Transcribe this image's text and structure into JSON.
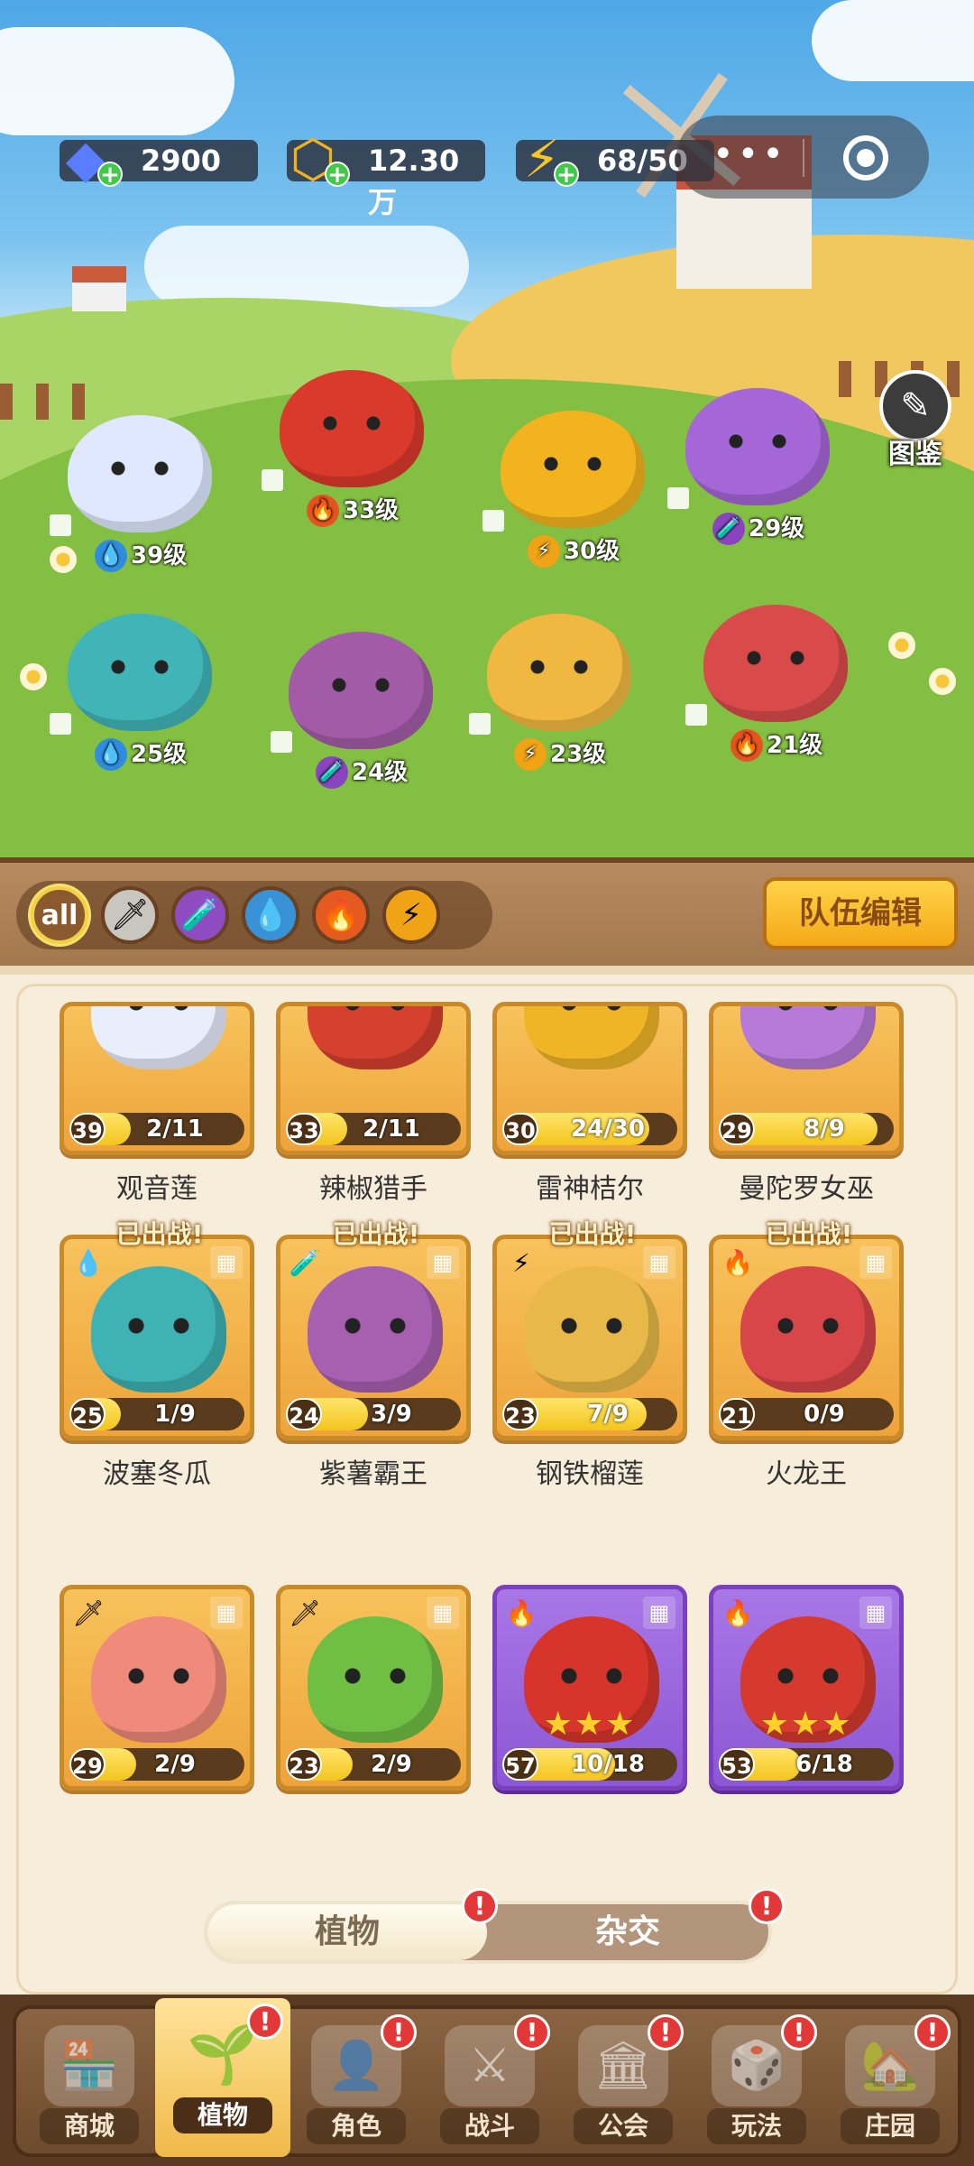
{
  "resources": {
    "gems": "2900",
    "coins": "12.30万",
    "energy": "68/50"
  },
  "miniapp": {
    "more": "•••"
  },
  "atlas_label": "图鉴",
  "field_plants": [
    {
      "level": "39级",
      "element": "water",
      "color": "#dfe8ff"
    },
    {
      "level": "33级",
      "element": "fire",
      "color": "#d93a2b"
    },
    {
      "level": "30级",
      "element": "thunder",
      "color": "#f2b31f"
    },
    {
      "level": "29级",
      "element": "poison",
      "color": "#a566d8"
    },
    {
      "level": "25级",
      "element": "water",
      "color": "#41b4b8"
    },
    {
      "level": "24级",
      "element": "poison",
      "color": "#a35ba7"
    },
    {
      "level": "23级",
      "element": "thunder",
      "color": "#f0b841"
    },
    {
      "level": "21级",
      "element": "fire",
      "color": "#d94a4a"
    }
  ],
  "filters": {
    "all": "all",
    "icons": [
      "sword-icon",
      "poison-icon",
      "water-icon",
      "fire-icon",
      "thunder-icon"
    ]
  },
  "team_edit": "队伍编辑",
  "row1": [
    {
      "name": "观音莲",
      "level": "39",
      "progress": "2/11",
      "pct": 0.18
    },
    {
      "name": "辣椒猎手",
      "level": "33",
      "progress": "2/11",
      "pct": 0.18
    },
    {
      "name": "雷神桔尔",
      "level": "30",
      "progress": "24/30",
      "pct": 0.8
    },
    {
      "name": "曼陀罗女巫",
      "level": "29",
      "progress": "8/9",
      "pct": 0.88
    }
  ],
  "deployed_label": "已出战!",
  "row2": [
    {
      "name": "波塞冬瓜",
      "level": "25",
      "progress": "1/9",
      "pct": 0.11,
      "element": "💧",
      "art": "#3fb2b4"
    },
    {
      "name": "紫薯霸王",
      "level": "24",
      "progress": "3/9",
      "pct": 0.33,
      "element": "🧪",
      "art": "#a760b0"
    },
    {
      "name": "钢铁榴莲",
      "level": "23",
      "progress": "7/9",
      "pct": 0.78,
      "element": "⚡",
      "art": "#e8b948"
    },
    {
      "name": "火龙王",
      "level": "21",
      "progress": "0/9",
      "pct": 0.0,
      "element": "🔥",
      "art": "#d8464a"
    }
  ],
  "row3": [
    {
      "level": "29",
      "progress": "2/9",
      "pct": 0.22,
      "element": "🗡",
      "art": "#f08a7a"
    },
    {
      "level": "23",
      "progress": "2/9",
      "pct": 0.22,
      "element": "🗡",
      "art": "#6fbf45"
    },
    {
      "level": "57",
      "progress": "10/18",
      "pct": 0.55,
      "element": "🔥",
      "art": "#d7352c",
      "stars": "★★★"
    },
    {
      "level": "53",
      "progress": "6/18",
      "pct": 0.33,
      "element": "🔥",
      "art": "#d63a2f",
      "stars": "★★★"
    }
  ],
  "toggle": {
    "plants": "植物",
    "hybrid": "杂交"
  },
  "nav": [
    {
      "label": "商城"
    },
    {
      "label": "植物"
    },
    {
      "label": "角色"
    },
    {
      "label": "战斗"
    },
    {
      "label": "公会"
    },
    {
      "label": "玩法"
    },
    {
      "label": "庄园"
    }
  ]
}
